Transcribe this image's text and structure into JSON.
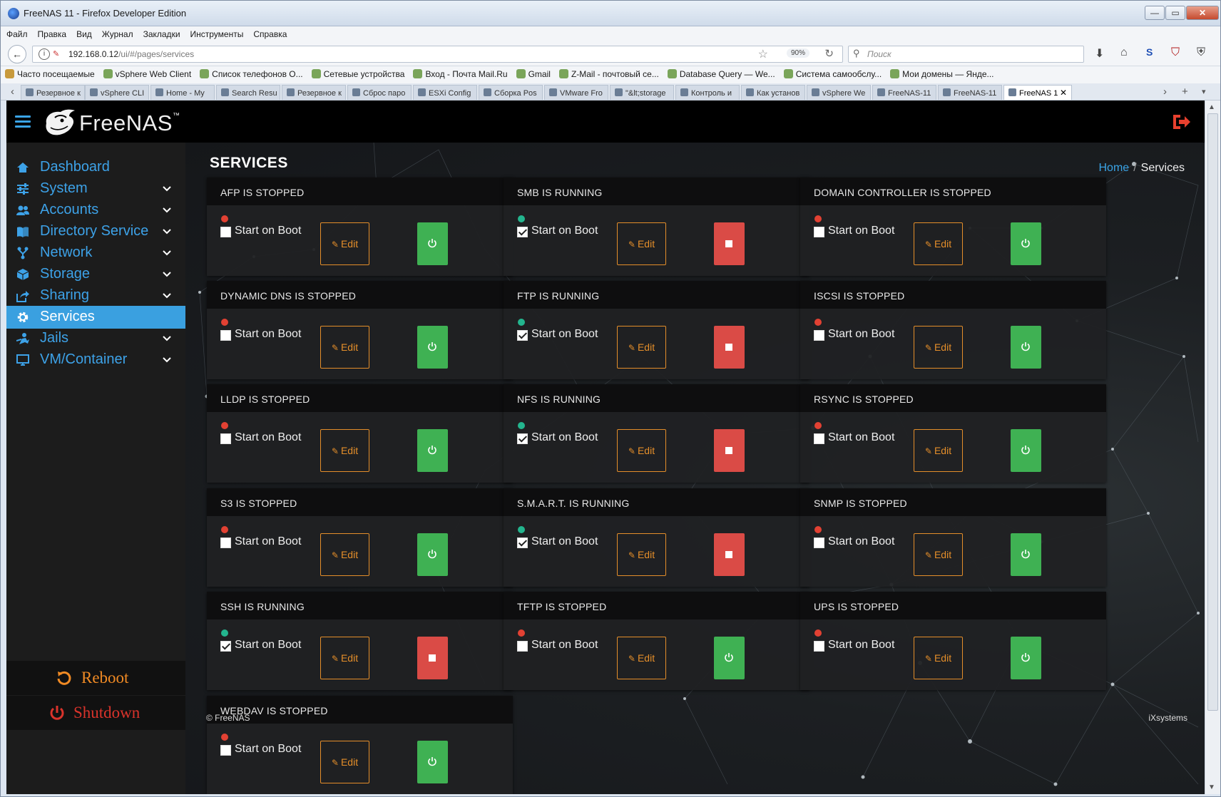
{
  "window": {
    "title": "FreeNAS 11 - Firefox Developer Edition",
    "controls": {
      "minimize": "—",
      "maximize": "▭",
      "close": "✕"
    }
  },
  "menu": [
    "Файл",
    "Правка",
    "Вид",
    "Журнал",
    "Закладки",
    "Инструменты",
    "Справка"
  ],
  "url": {
    "host": "192.168.0.12",
    "path": "/ui/#/pages/services",
    "zoom": "90%"
  },
  "search": {
    "placeholder": "Поиск"
  },
  "bookmarks": [
    "Часто посещаемые",
    "vSphere Web Client",
    "Список телефонов О...",
    "Сетевые устройства",
    "Вход - Почта Mail.Ru",
    "Gmail",
    "Z-Mail - почтовый се...",
    "Database Query — We...",
    "Система самообслу...",
    "Мои домены — Янде..."
  ],
  "tabs": [
    "Резервное к",
    "vSphere CLI",
    "Home - My",
    "Search Resu",
    "Резервное к",
    "Сброс паро",
    "ESXi Config",
    "Сборка Pos",
    "VMware Fro",
    "\"&lt;storage",
    "Контроль и",
    "Как установ",
    "vSphere We",
    "FreeNAS-11",
    "FreeNAS-11",
    "FreeNAS 1"
  ],
  "app": {
    "brand": "FreeNAS",
    "page_title": "SERVICES",
    "breadcrumb": {
      "home": "Home",
      "separator": "/",
      "current": "Services"
    },
    "footer_left": "© FreeNAS",
    "footer_right": "iXsystems",
    "accent": "#3aa4e6",
    "sidebar": [
      {
        "label": "Dashboard",
        "icon": "home-icon",
        "expandable": false,
        "active": false
      },
      {
        "label": "System",
        "icon": "sliders-icon",
        "expandable": true,
        "active": false
      },
      {
        "label": "Accounts",
        "icon": "users-icon",
        "expandable": true,
        "active": false
      },
      {
        "label": "Directory Service",
        "icon": "book-icon",
        "expandable": true,
        "active": false
      },
      {
        "label": "Network",
        "icon": "network-icon",
        "expandable": true,
        "active": false
      },
      {
        "label": "Storage",
        "icon": "cube-icon",
        "expandable": true,
        "active": false
      },
      {
        "label": "Sharing",
        "icon": "share-icon",
        "expandable": true,
        "active": false
      },
      {
        "label": "Services",
        "icon": "gear-icon",
        "expandable": false,
        "active": true
      },
      {
        "label": "Jails",
        "icon": "jail-icon",
        "expandable": true,
        "active": false
      },
      {
        "label": "VM/Container",
        "icon": "monitor-icon",
        "expandable": true,
        "active": false
      }
    ],
    "reboot_label": "Reboot",
    "shutdown_label": "Shutdown",
    "start_on_boot_label": "Start on Boot",
    "edit_label": "Edit",
    "services": [
      {
        "title": "AFP IS STOPPED",
        "status": "stopped",
        "start_on_boot": false
      },
      {
        "title": "SMB IS RUNNING",
        "status": "running",
        "start_on_boot": true
      },
      {
        "title": "DOMAIN CONTROLLER IS STOPPED",
        "status": "stopped",
        "start_on_boot": false
      },
      {
        "title": "DYNAMIC DNS IS STOPPED",
        "status": "stopped",
        "start_on_boot": false
      },
      {
        "title": "FTP IS RUNNING",
        "status": "running",
        "start_on_boot": true
      },
      {
        "title": "ISCSI IS STOPPED",
        "status": "stopped",
        "start_on_boot": false
      },
      {
        "title": "LLDP IS STOPPED",
        "status": "stopped",
        "start_on_boot": false
      },
      {
        "title": "NFS IS RUNNING",
        "status": "running",
        "start_on_boot": true
      },
      {
        "title": "RSYNC IS STOPPED",
        "status": "stopped",
        "start_on_boot": false
      },
      {
        "title": "S3 IS STOPPED",
        "status": "stopped",
        "start_on_boot": false
      },
      {
        "title": "S.M.A.R.T. IS RUNNING",
        "status": "running",
        "start_on_boot": true
      },
      {
        "title": "SNMP IS STOPPED",
        "status": "stopped",
        "start_on_boot": false
      },
      {
        "title": "SSH IS RUNNING",
        "status": "running",
        "start_on_boot": true
      },
      {
        "title": "TFTP IS STOPPED",
        "status": "stopped",
        "start_on_boot": false
      },
      {
        "title": "UPS IS STOPPED",
        "status": "stopped",
        "start_on_boot": false
      },
      {
        "title": "WEBDAV IS STOPPED",
        "status": "stopped",
        "start_on_boot": false
      }
    ],
    "colors": {
      "running": "#23b58e",
      "stopped": "#e24133",
      "start_button": "#3fb153",
      "stop_button": "#da4b46",
      "edit": "#e48e2a"
    }
  }
}
